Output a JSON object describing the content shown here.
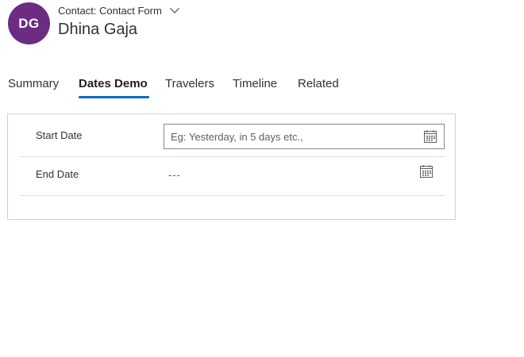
{
  "header": {
    "avatar_initials": "DG",
    "avatar_color": "#6b2c82",
    "form_label": "Contact: Contact Form",
    "record_name": "Dhina Gaja",
    "form_selector_icon": "chevron-down-icon"
  },
  "tabs": {
    "items": [
      {
        "label": "Summary",
        "active": false
      },
      {
        "label": "Dates Demo",
        "active": true
      },
      {
        "label": "Travelers",
        "active": false
      },
      {
        "label": "Timeline",
        "active": false
      },
      {
        "label": "Related",
        "active": false
      }
    ],
    "accent_color": "#0f6cbd"
  },
  "fields": {
    "start_date": {
      "label": "Start Date",
      "value": "",
      "placeholder": "Eg: Yesterday, in 5 days etc.,",
      "icon": "calendar-icon"
    },
    "end_date": {
      "label": "End Date",
      "value": "---",
      "icon": "calendar-icon"
    }
  }
}
